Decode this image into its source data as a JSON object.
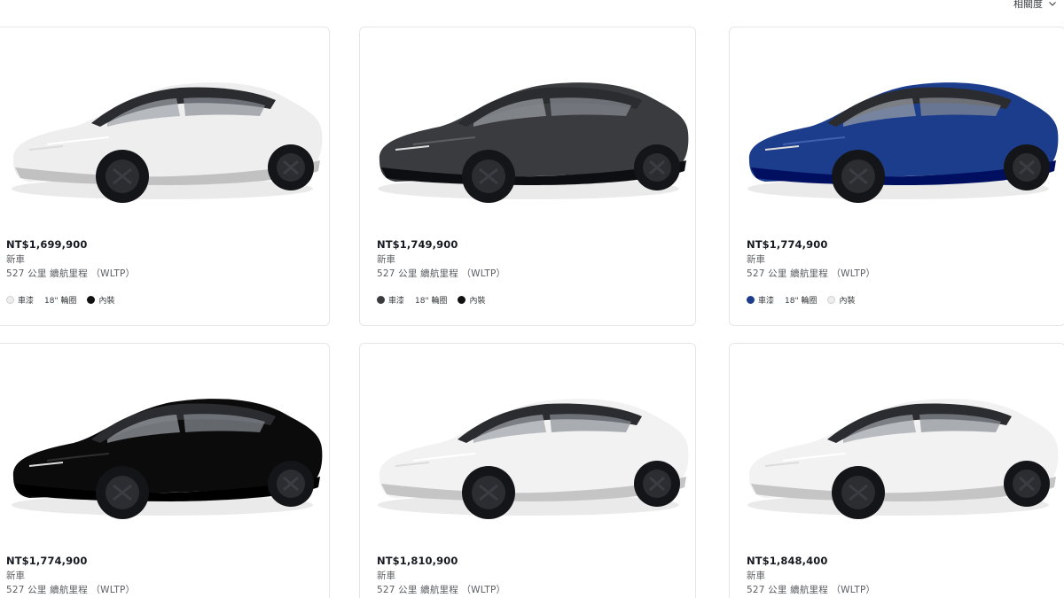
{
  "sort": {
    "label": "相關度"
  },
  "cards": [
    {
      "price": "NT$1,699,900",
      "condition": "新車",
      "range": "527 公里 續航里程 （WLTP）",
      "paint_label": "車漆",
      "wheel_label": "18\" 輪圈",
      "interior_label": "內裝",
      "paint_color": "#eeeeee",
      "interior_color": "#111111"
    },
    {
      "price": "NT$1,749,900",
      "condition": "新車",
      "range": "527 公里 續航里程 （WLTP）",
      "paint_label": "車漆",
      "wheel_label": "18\" 輪圈",
      "interior_label": "內裝",
      "paint_color": "#3a3b3e",
      "interior_color": "#111111"
    },
    {
      "price": "NT$1,774,900",
      "condition": "新車",
      "range": "527 公里 續航里程 （WLTP）",
      "paint_label": "車漆",
      "wheel_label": "18\" 輪圈",
      "interior_label": "內裝",
      "paint_color": "#1c3c8c",
      "interior_color": "#eeeeee"
    },
    {
      "price": "NT$1,774,900",
      "condition": "新車",
      "range": "527 公里 續航里程 （WLTP）",
      "paint_color": "#0b0b0c"
    },
    {
      "price": "NT$1,810,900",
      "condition": "新車",
      "range": "527 公里 續航里程 （WLTP）",
      "paint_color": "#f2f2f2"
    },
    {
      "price": "NT$1,848,400",
      "condition": "新車",
      "range": "527 公里 續航里程 （WLTP）",
      "paint_color": "#f2f2f2"
    }
  ]
}
